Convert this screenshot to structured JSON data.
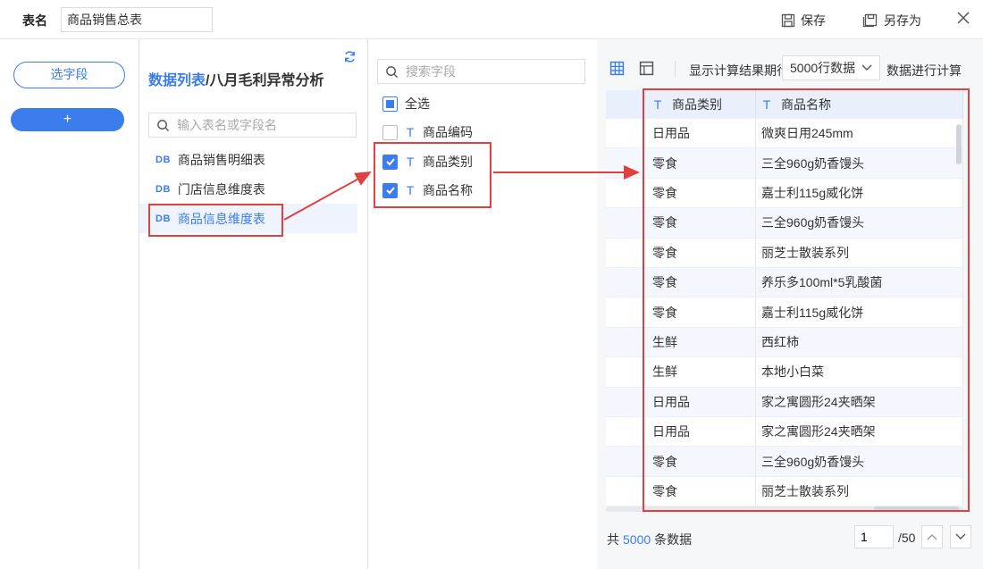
{
  "topbar": {
    "name_label": "表名",
    "name_value": "商品销售总表",
    "save_label": "保存",
    "save_as_label": "另存为"
  },
  "left": {
    "select_field_label": "选字段",
    "add_label": "+"
  },
  "tables": {
    "title_prefix": "数据列表",
    "title_suffix": "/八月毛利异常分析",
    "search_placeholder": "输入表名或字段名",
    "items": [
      {
        "db": "DB",
        "label": "商品销售明细表"
      },
      {
        "db": "DB",
        "label": "门店信息维度表"
      },
      {
        "db": "DB",
        "label": "商品信息维度表"
      }
    ]
  },
  "fields": {
    "search_placeholder": "搜索字段",
    "select_all_label": "全选",
    "items": [
      {
        "type": "T",
        "label": "商品编码",
        "checked": false
      },
      {
        "type": "T",
        "label": "商品类别",
        "checked": true
      },
      {
        "type": "T",
        "label": "商品名称",
        "checked": true
      }
    ]
  },
  "preview": {
    "show_text": "显示计算结果",
    "before_text": "前",
    "select_value": "5000行数据",
    "after_text": "数据进行计算",
    "overlap_text": "期行",
    "columns": [
      {
        "type": "T",
        "label": "商品类别"
      },
      {
        "type": "T",
        "label": "商品名称"
      }
    ],
    "rows": [
      [
        "日用品",
        "微爽日用245mm"
      ],
      [
        "零食",
        "三全960g奶香馒头"
      ],
      [
        "零食",
        "嘉士利115g威化饼"
      ],
      [
        "零食",
        "三全960g奶香馒头"
      ],
      [
        "零食",
        "丽芝士散装系列"
      ],
      [
        "零食",
        "养乐多100ml*5乳酸菌"
      ],
      [
        "零食",
        "嘉士利115g威化饼"
      ],
      [
        "生鲜",
        "西红柿"
      ],
      [
        "生鲜",
        "本地小白菜"
      ],
      [
        "日用品",
        "家之寓圆形24夹晒架"
      ],
      [
        "日用品",
        "家之寓圆形24夹晒架"
      ],
      [
        "零食",
        "三全960g奶香馒头"
      ],
      [
        "零食",
        "丽芝士散装系列"
      ]
    ],
    "footer_prefix": "共",
    "footer_count": "5000",
    "footer_suffix": "条数据",
    "page_value": "1",
    "page_total": "/50"
  },
  "colors": {
    "accent": "#3b7ded",
    "highlight": "#e04040"
  }
}
